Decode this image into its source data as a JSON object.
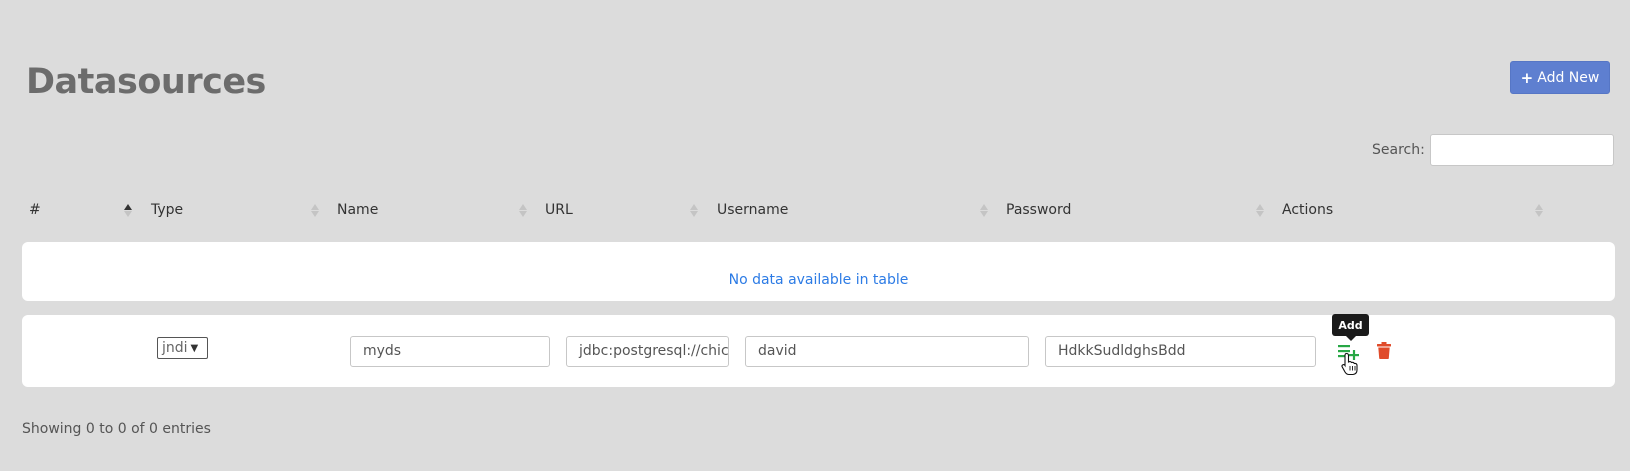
{
  "page": {
    "title": "Datasources"
  },
  "toolbar": {
    "add_new_label": "Add New",
    "add_new_icon": "plus-icon",
    "search_label": "Search:",
    "search_value": ""
  },
  "table": {
    "columns": [
      "#",
      "Type",
      "Name",
      "URL",
      "Username",
      "Password",
      "Actions"
    ],
    "sorted_column": "#",
    "sorted_direction": "ascending",
    "empty_message": "No data available in table"
  },
  "new_row": {
    "type_value": "jndi",
    "name_value": "myds",
    "url_value": "jdbc:postgresql://chic",
    "username_value": "david",
    "password_value": "HdkkSudldghsBdd",
    "actions": {
      "add_icon": "playlist-add-icon",
      "delete_icon": "trash-icon",
      "tooltip": "Add"
    }
  },
  "footer": {
    "info": "Showing 0 to 0 of 0 entries"
  },
  "colors": {
    "background": "#dcdcdc",
    "primary_button": "#5e7fd0",
    "empty_text": "#2c7be5",
    "add_icon": "#28a745",
    "delete_icon": "#e04b2a"
  }
}
